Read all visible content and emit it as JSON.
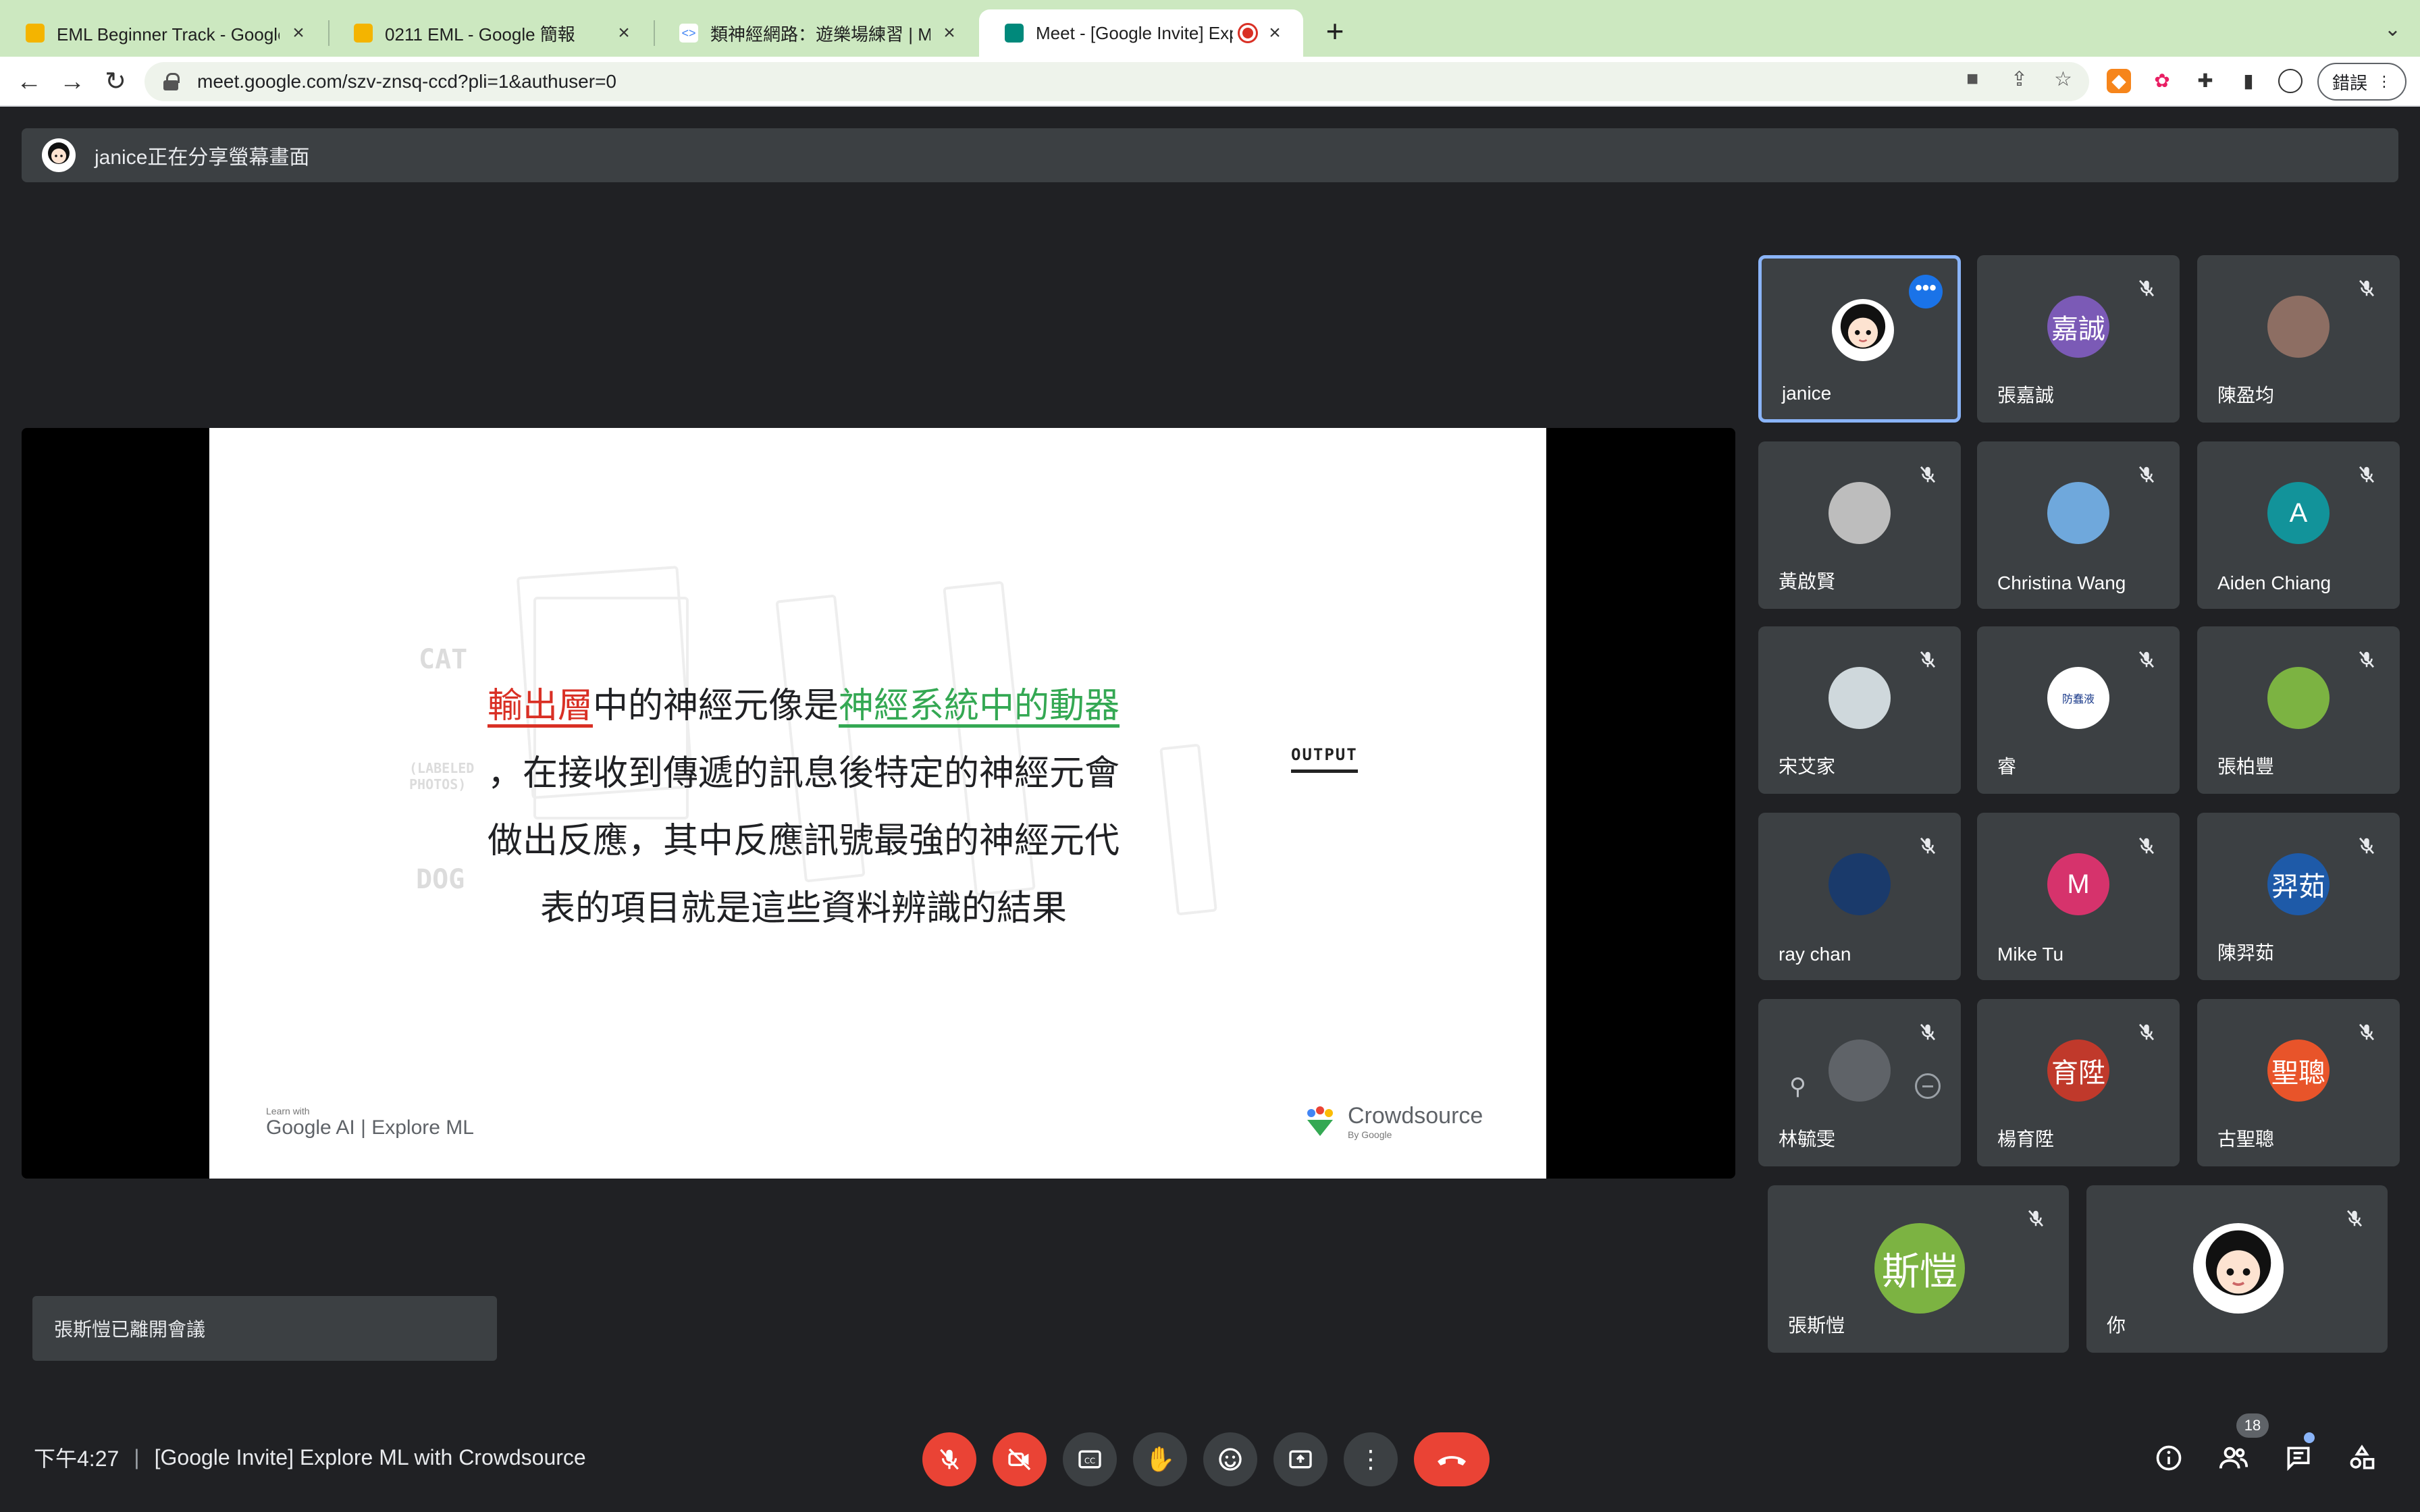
{
  "browser": {
    "tabs": [
      {
        "title": "EML Beginner Track - Google 簡",
        "favicon_color": "#f4b400"
      },
      {
        "title": "0211 EML - Google 簡報",
        "favicon_color": "#f4b400"
      },
      {
        "title": "類神經網路：遊樂場練習 | Machine",
        "favicon_color": "#ffffff"
      },
      {
        "title": "Meet - [Google Invite] Explore",
        "favicon_color": "#00897b"
      }
    ],
    "url": "meet.google.com/szv-znsq-ccd?pli=1&authuser=0",
    "error_button_label": "錯誤"
  },
  "share_banner": {
    "text": "janice正在分享螢幕畫面"
  },
  "slide": {
    "line1_part1": "輸出層",
    "line1_part2": "中的神經元像是",
    "line1_part3": "神經系統中的動器",
    "line2": "，在接收到傳遞的訊息後特定的神經元會",
    "line3": "做出反應，其中反應訊號最強的神經元代",
    "line4": "表的項目就是這些資料辨識的結果",
    "output_label": "OUTPUT",
    "ghost_cat": "CAT",
    "ghost_labeled": "(LABELED PHOTOS)",
    "ghost_dog": "DOG",
    "brand_left_small": "Learn with",
    "brand_left": "Google AI | Explore ML",
    "brand_right": "Crowdsource",
    "brand_right_small": "By Google"
  },
  "participants": [
    {
      "name": "janice",
      "avatar_text": "",
      "avatar_color": "#ffffff",
      "speaking": true
    },
    {
      "name": "張嘉誠",
      "avatar_text": "嘉誠",
      "avatar_color": "#7b5ab6"
    },
    {
      "name": "陳盈均",
      "avatar_text": "",
      "avatar_color": "#8d6e63"
    },
    {
      "name": "黃啟賢",
      "avatar_text": "",
      "avatar_color": "#bdbdbd"
    },
    {
      "name": "Christina Wang",
      "avatar_text": "",
      "avatar_color": "#6fa8dc"
    },
    {
      "name": "Aiden Chiang",
      "avatar_text": "A",
      "avatar_color": "#12939a"
    },
    {
      "name": "宋艾家",
      "avatar_text": "",
      "avatar_color": "#cfd8dc"
    },
    {
      "name": "睿",
      "avatar_text": "防蠢液",
      "avatar_color": "#ffffff"
    },
    {
      "name": "張柏豐",
      "avatar_text": "",
      "avatar_color": "#7cb342"
    },
    {
      "name": "ray chan",
      "avatar_text": "",
      "avatar_color": "#1a3a6b"
    },
    {
      "name": "Mike Tu",
      "avatar_text": "M",
      "avatar_color": "#d6336c"
    },
    {
      "name": "陳羿茹",
      "avatar_text": "羿茹",
      "avatar_color": "#1e5aa8"
    },
    {
      "name": "林毓雯",
      "avatar_text": "",
      "avatar_color": "#5f6368"
    },
    {
      "name": "楊育陞",
      "avatar_text": "育陞",
      "avatar_color": "#c0392b"
    },
    {
      "name": "古聖聰",
      "avatar_text": "聖聰",
      "avatar_color": "#e8542a"
    },
    {
      "name": "張斯愷",
      "avatar_text": "斯愷",
      "avatar_color": "#7cb342"
    },
    {
      "name": "你",
      "avatar_text": "",
      "avatar_color": "#ffffff"
    }
  ],
  "toast": {
    "text": "張斯愷已離開會議"
  },
  "bottom_bar": {
    "time": "下午4:27",
    "meeting_title": "[Google Invite] Explore ML with Crowdsource",
    "people_count": "18"
  }
}
